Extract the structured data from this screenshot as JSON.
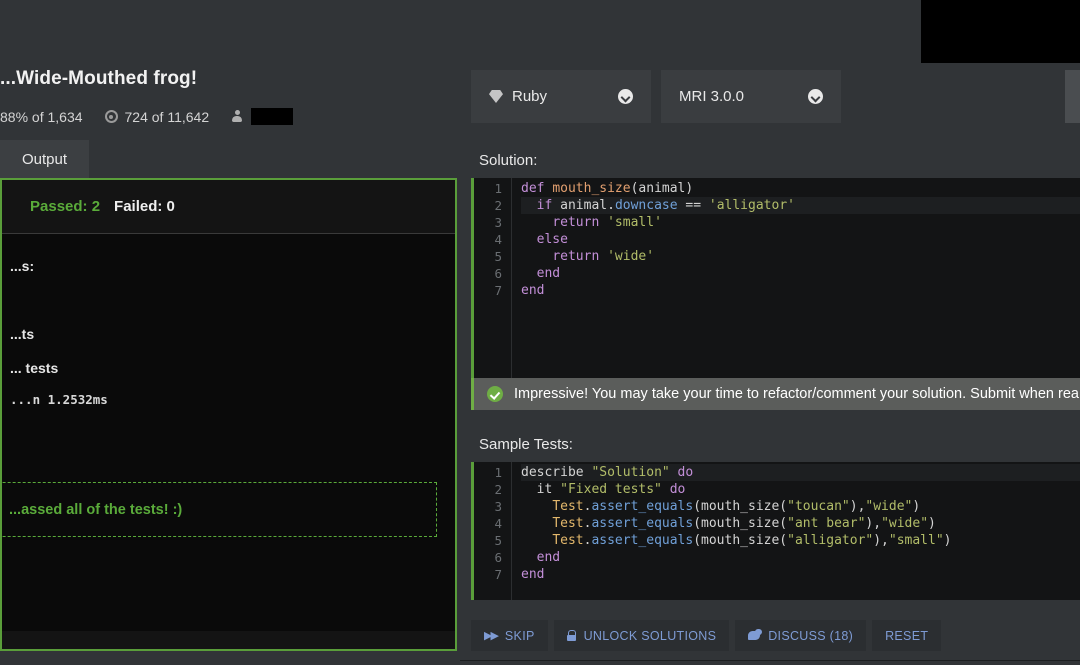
{
  "kata": {
    "title": "...Wide-Mouthed frog!",
    "stats": {
      "completion_percent": "88% of 1,634",
      "rank_icon": "target-icon",
      "rank_value": "724 of 11,642",
      "user_icon": "person-icon",
      "username_redacted": ""
    }
  },
  "left_panel": {
    "tabs": [
      {
        "label": "Output",
        "active": true
      }
    ],
    "results": {
      "passed_label": "Passed: 2",
      "failed_label": "Failed: 0"
    },
    "output_lines": [
      "...s:",
      "...ts",
      "... tests"
    ],
    "timing_line": "...n 1.2532ms",
    "success_message": "...assed all of the tests! :)"
  },
  "right_panel": {
    "language_select": {
      "icon": "ruby-gem-icon",
      "value": "Ruby",
      "chevron": "chevron-down-icon"
    },
    "version_select": {
      "value": "MRI 3.0.0",
      "chevron": "chevron-down-icon"
    },
    "solution_label": "Solution:",
    "tests_label": "Sample Tests:",
    "banner": {
      "icon": "check-circle-icon",
      "text": "Impressive! You may take your time to refactor/comment your solution. Submit when rea"
    },
    "solution_code": {
      "lines": [
        {
          "n": "1",
          "tokens": [
            {
              "t": "def ",
              "c": "kw"
            },
            {
              "t": "mouth_size",
              "c": "fn"
            },
            {
              "t": "(animal)",
              "c": "pl"
            }
          ],
          "highlight": false
        },
        {
          "n": "2",
          "tokens": [
            {
              "t": "  ",
              "c": "pl"
            },
            {
              "t": "if ",
              "c": "kw"
            },
            {
              "t": "animal",
              "c": "pl"
            },
            {
              "t": ".",
              "c": "pl"
            },
            {
              "t": "downcase",
              "c": "meth"
            },
            {
              "t": " == ",
              "c": "pl"
            },
            {
              "t": "'alligator'",
              "c": "str"
            }
          ],
          "highlight": true
        },
        {
          "n": "3",
          "tokens": [
            {
              "t": "    ",
              "c": "pl"
            },
            {
              "t": "return ",
              "c": "kw"
            },
            {
              "t": "'small'",
              "c": "str"
            }
          ],
          "highlight": false
        },
        {
          "n": "4",
          "tokens": [
            {
              "t": "  ",
              "c": "pl"
            },
            {
              "t": "else",
              "c": "kw"
            }
          ],
          "highlight": false
        },
        {
          "n": "5",
          "tokens": [
            {
              "t": "    ",
              "c": "pl"
            },
            {
              "t": "return ",
              "c": "kw"
            },
            {
              "t": "'wide'",
              "c": "str"
            }
          ],
          "highlight": false
        },
        {
          "n": "6",
          "tokens": [
            {
              "t": "  ",
              "c": "pl"
            },
            {
              "t": "end",
              "c": "kw"
            }
          ],
          "highlight": false
        },
        {
          "n": "7",
          "tokens": [
            {
              "t": "end",
              "c": "kw"
            }
          ],
          "highlight": false
        }
      ]
    },
    "tests_code": {
      "lines": [
        {
          "n": "1",
          "tokens": [
            {
              "t": "describe ",
              "c": "pl"
            },
            {
              "t": "\"Solution\"",
              "c": "str"
            },
            {
              "t": " do",
              "c": "kw"
            }
          ],
          "highlight": true
        },
        {
          "n": "2",
          "tokens": [
            {
              "t": "  it ",
              "c": "pl"
            },
            {
              "t": "\"Fixed tests\"",
              "c": "str"
            },
            {
              "t": " do",
              "c": "kw"
            }
          ],
          "highlight": false
        },
        {
          "n": "3",
          "tokens": [
            {
              "t": "    ",
              "c": "pl"
            },
            {
              "t": "Test",
              "c": "cnst"
            },
            {
              "t": ".",
              "c": "pl"
            },
            {
              "t": "assert_equals",
              "c": "meth"
            },
            {
              "t": "(mouth_size(",
              "c": "pl"
            },
            {
              "t": "\"toucan\"",
              "c": "str"
            },
            {
              "t": "),",
              "c": "pl"
            },
            {
              "t": "\"wide\"",
              "c": "str"
            },
            {
              "t": ")",
              "c": "pl"
            }
          ],
          "highlight": false
        },
        {
          "n": "4",
          "tokens": [
            {
              "t": "    ",
              "c": "pl"
            },
            {
              "t": "Test",
              "c": "cnst"
            },
            {
              "t": ".",
              "c": "pl"
            },
            {
              "t": "assert_equals",
              "c": "meth"
            },
            {
              "t": "(mouth_size(",
              "c": "pl"
            },
            {
              "t": "\"ant bear\"",
              "c": "str"
            },
            {
              "t": "),",
              "c": "pl"
            },
            {
              "t": "\"wide\"",
              "c": "str"
            },
            {
              "t": ")",
              "c": "pl"
            }
          ],
          "highlight": false
        },
        {
          "n": "5",
          "tokens": [
            {
              "t": "    ",
              "c": "pl"
            },
            {
              "t": "Test",
              "c": "cnst"
            },
            {
              "t": ".",
              "c": "pl"
            },
            {
              "t": "assert_equals",
              "c": "meth"
            },
            {
              "t": "(mouth_size(",
              "c": "pl"
            },
            {
              "t": "\"alligator\"",
              "c": "str"
            },
            {
              "t": "),",
              "c": "pl"
            },
            {
              "t": "\"small\"",
              "c": "str"
            },
            {
              "t": ")",
              "c": "pl"
            }
          ],
          "highlight": false
        },
        {
          "n": "6",
          "tokens": [
            {
              "t": "  end",
              "c": "kw"
            }
          ],
          "highlight": false
        },
        {
          "n": "7",
          "tokens": [
            {
              "t": "end",
              "c": "kw"
            }
          ],
          "highlight": false
        }
      ]
    },
    "actions": [
      {
        "label": "SKIP",
        "icon": "fast-forward-icon"
      },
      {
        "label": "UNLOCK SOLUTIONS",
        "icon": "lock-icon"
      },
      {
        "label": "DISCUSS (18)",
        "icon": "chat-bubble-icon"
      },
      {
        "label": "RESET",
        "icon": null
      }
    ]
  },
  "colors": {
    "page_bg": "#313437",
    "panel_bg": "#3a3d40",
    "editor_bg": "#131415",
    "accent_green": "#5a9e3a",
    "banner_bg": "#5b5d5b",
    "action_text": "#7e9bd4"
  }
}
